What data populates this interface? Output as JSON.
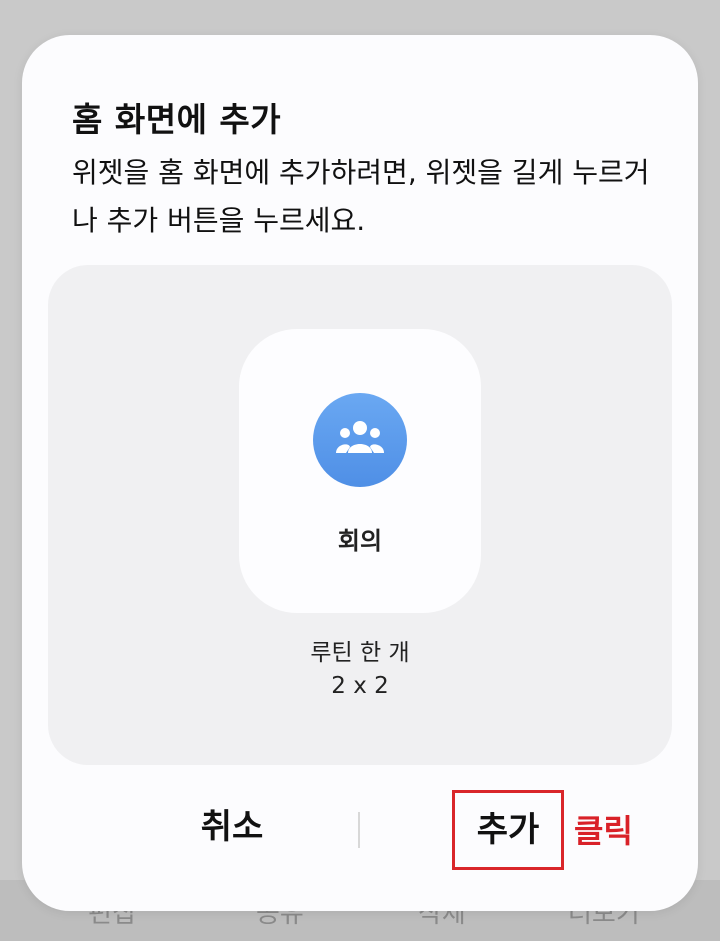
{
  "background_bar": {
    "items": [
      "편집",
      "공유",
      "삭제",
      "더보기"
    ]
  },
  "dialog": {
    "title": "홈 화면에 추가",
    "description": "위젯을 홈 화면에 추가하려면, 위젯을 길게 누르거나 추가 버튼을 누르세요.",
    "widget": {
      "icon": "people-group-icon",
      "name": "회의",
      "description": "루틴 한 개",
      "size": "2 x 2"
    },
    "buttons": {
      "cancel_label": "취소",
      "add_label": "추가"
    }
  },
  "annotation": {
    "click_label": "클릭",
    "color": "#d92128"
  },
  "colors": {
    "icon_circle": "#5b9bec",
    "preview_bg": "#f0f0f2",
    "dialog_bg": "#fcfcfe"
  }
}
